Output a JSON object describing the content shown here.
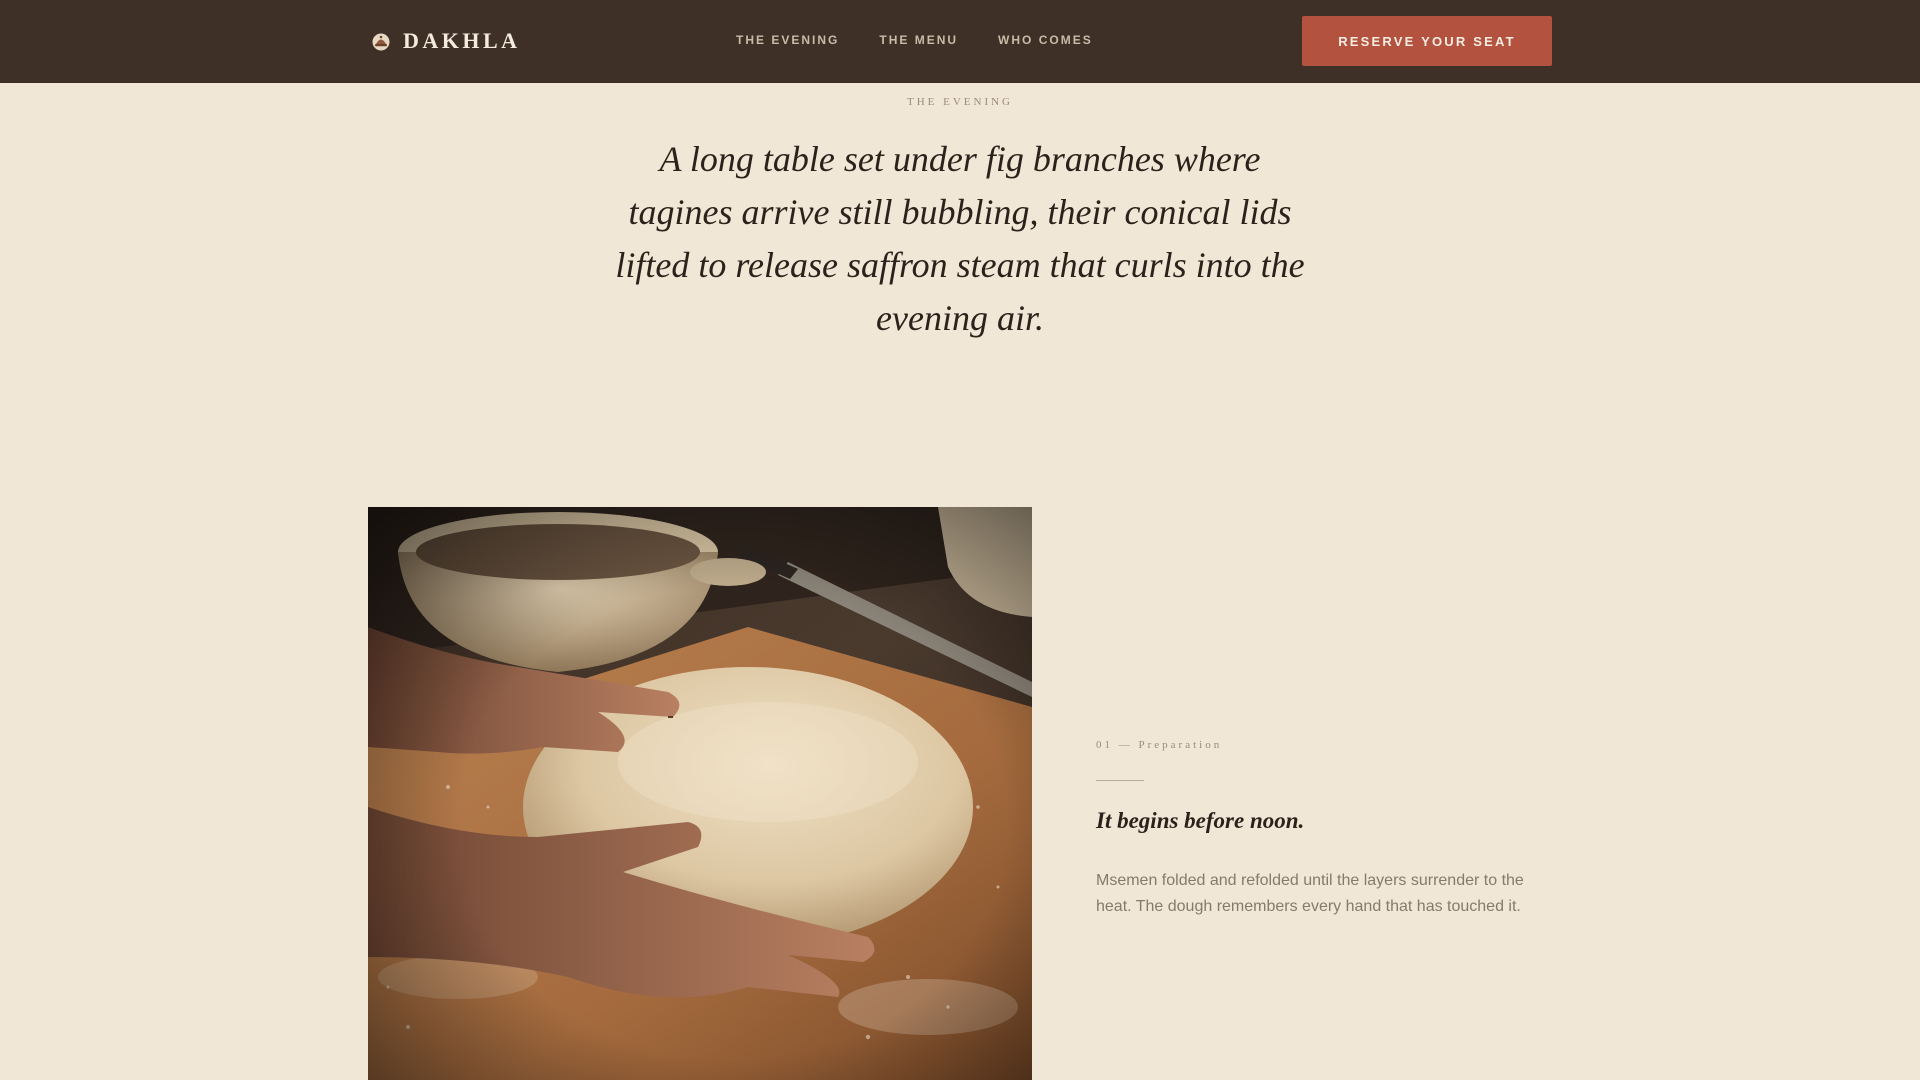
{
  "nav": {
    "brand": "DAKHLA",
    "brand_icon": "tagine-icon",
    "links": [
      "THE EVENING",
      "THE MENU",
      "WHO COMES"
    ],
    "cta": "RESERVE YOUR SEAT"
  },
  "intro": {
    "eyebrow": "THE EVENING",
    "lede": "A long table set under fig branches where tagines arrive still bubbling, their conical lids lifted to release saffron steam that curls into the evening air."
  },
  "story": {
    "step_label": "01 — Preparation",
    "heading": "It begins before noon.",
    "body": "Msemen folded and refolded until the layers surrender to the heat. The dough remembers every hand that has touched it."
  },
  "colors": {
    "nav_background": "#3e3027",
    "page_background": "#f1e7d7",
    "accent": "#b2523f"
  }
}
